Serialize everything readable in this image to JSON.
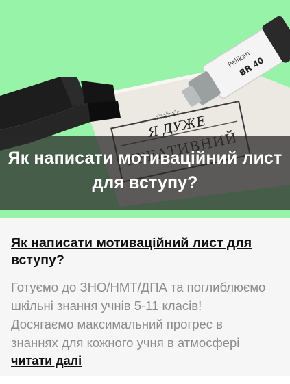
{
  "card": {
    "image_caption_lines": [
      "Як написати мотиваційний лист",
      "для вступу?"
    ],
    "stamp_text": {
      "stars": "☆☆☆",
      "line1": "Я ДУЖЕ",
      "line2": "КРЕАТИВНИЙ",
      "marker_brand": "Pelikan",
      "marker_model": "BR 40"
    },
    "title_lines": [
      "Як написати мотиваційний лист для",
      "вступу?"
    ],
    "excerpt_lines": [
      "Готуємо до ЗНО/НМТ/ДПА та поглиблюємо",
      "шкільні знання учнів 5-11 класів!",
      "Досягаємо максимальний прогрес в",
      "знаннях для кожного учня в атмосфері"
    ],
    "read_more": "читати далі"
  },
  "colors": {
    "hero_background": "#96f3a7",
    "overlay": "#282828",
    "excerpt_text": "#8c8c8c",
    "title_text": "#111111"
  }
}
